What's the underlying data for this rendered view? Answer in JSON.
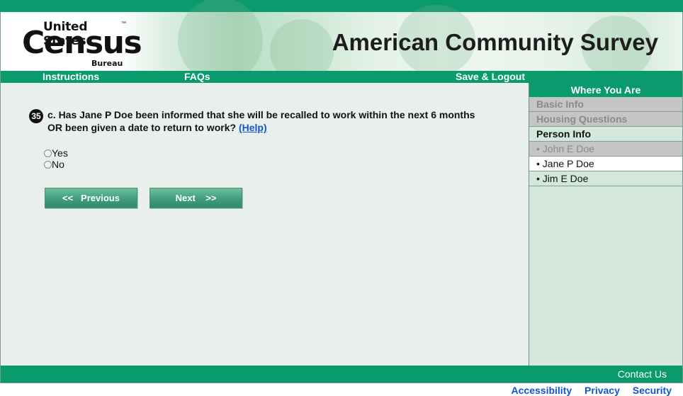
{
  "header": {
    "logo": {
      "line1": "United States",
      "line2": "Census",
      "line3": "Bureau",
      "tm": "™"
    },
    "title": "American Community Survey"
  },
  "nav": {
    "instructions": "Instructions",
    "faqs": "FAQs",
    "save_logout": "Save & Logout"
  },
  "question": {
    "number": "35",
    "line1": "c. Has Jane P Doe been informed that she will be recalled to work within the next 6 months",
    "line2": "OR been given a date to return to work?",
    "help": "(Help)",
    "options": [
      "Yes",
      "No"
    ]
  },
  "buttons": {
    "previous": "<<   Previous",
    "next": "Next    >>"
  },
  "sidebar": {
    "title": "Where You Are",
    "basic_info": "Basic Info",
    "housing": "Housing Questions",
    "person_info": "Person Info",
    "people": [
      "• John E Doe",
      "• Jane P Doe",
      "• Jim E Doe"
    ]
  },
  "footer": {
    "contact": "Contact Us",
    "links": [
      "Accessibility",
      "Privacy",
      "Security"
    ]
  },
  "colors": {
    "brand_green": "#0a9a6e",
    "link_blue": "#1155cc"
  }
}
